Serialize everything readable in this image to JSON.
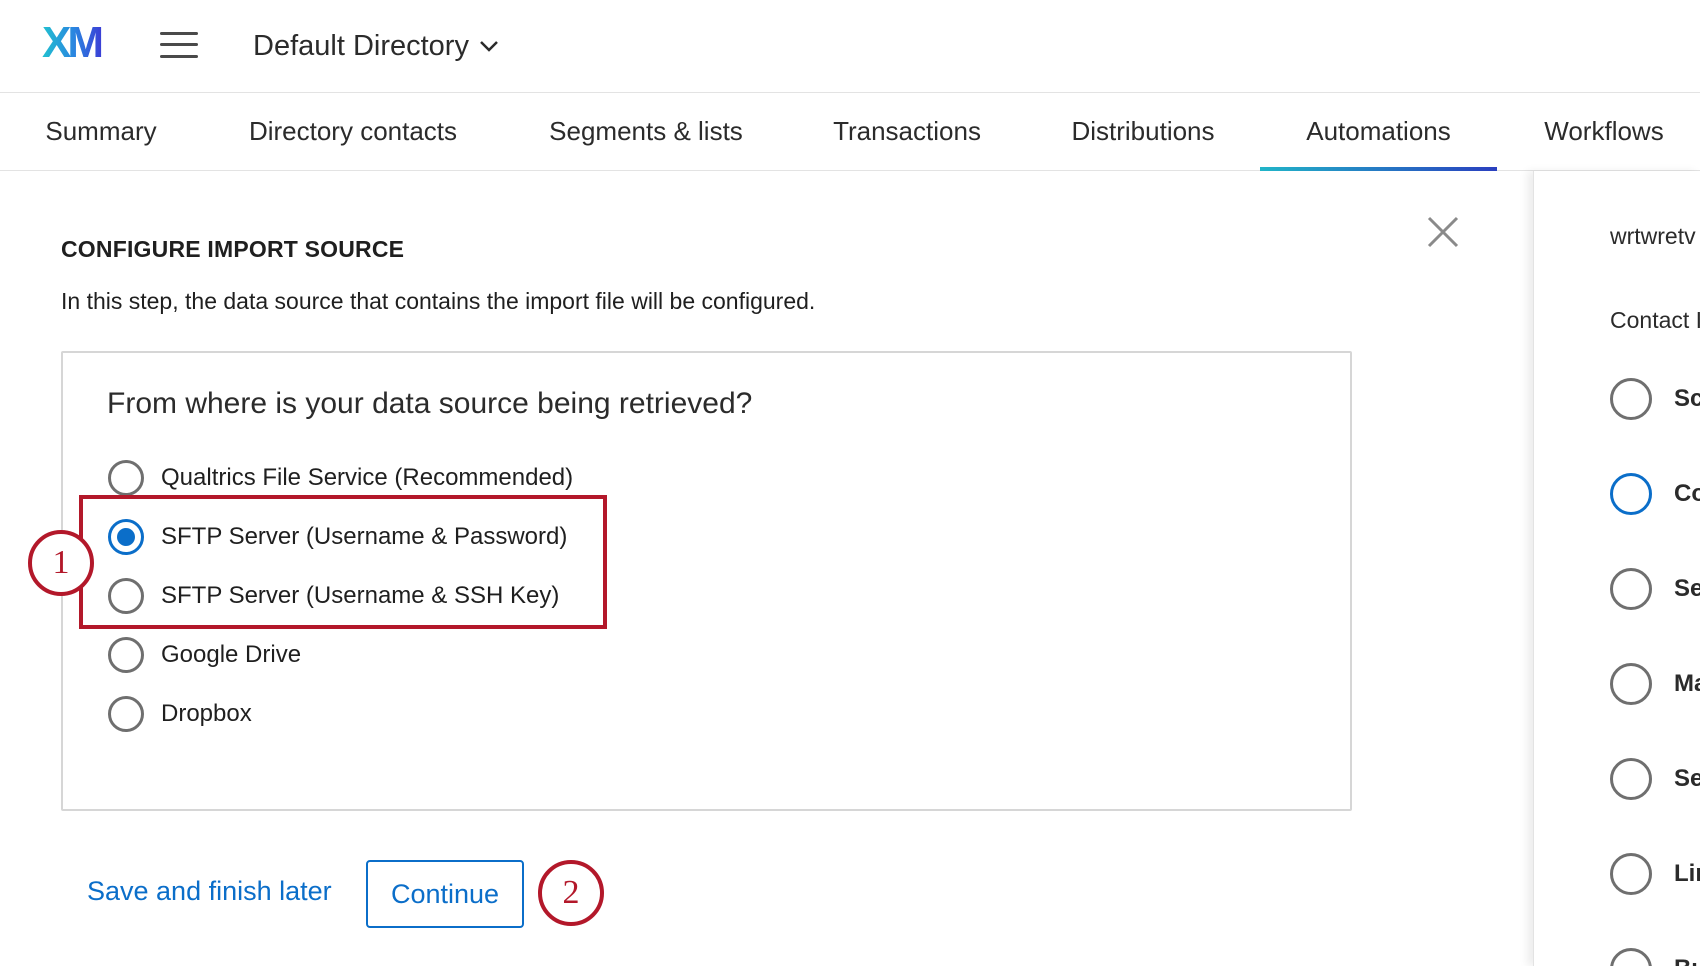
{
  "header": {
    "logo_text": "XM",
    "directory_name": "Default Directory"
  },
  "tabs": [
    {
      "label": "Summary",
      "active": false
    },
    {
      "label": "Directory contacts",
      "active": false
    },
    {
      "label": "Segments & lists",
      "active": false
    },
    {
      "label": "Transactions",
      "active": false
    },
    {
      "label": "Distributions",
      "active": false
    },
    {
      "label": "Automations",
      "active": true
    },
    {
      "label": "Workflows",
      "active": false
    }
  ],
  "panel": {
    "heading": "CONFIGURE IMPORT SOURCE",
    "description": "In this step, the data source that contains the import file will be configured.",
    "question": "From where is your data source being retrieved?",
    "options": [
      {
        "label": "Qualtrics File Service (Recommended)",
        "selected": false
      },
      {
        "label": "SFTP Server (Username & Password)",
        "selected": true
      },
      {
        "label": "SFTP Server (Username & SSH Key)",
        "selected": false
      },
      {
        "label": "Google Drive",
        "selected": false
      },
      {
        "label": "Dropbox",
        "selected": false
      }
    ],
    "save_label": "Save and finish later",
    "continue_label": "Continue"
  },
  "callouts": [
    "1",
    "2"
  ],
  "right_panel": {
    "title": "wrtwretv",
    "subtitle": "Contact I",
    "items": [
      {
        "label": "Sc",
        "active": false
      },
      {
        "label": "Co",
        "active": true
      },
      {
        "label": "Se",
        "active": false
      },
      {
        "label": "Ma",
        "active": false
      },
      {
        "label": "Se",
        "active": false
      },
      {
        "label": "Lir",
        "active": false
      },
      {
        "label": "Bu",
        "active": false
      }
    ]
  },
  "colors": {
    "accent": "#0b6ec9",
    "highlight": "#b3182a",
    "tab_underline_start": "#21b5c8",
    "tab_underline_end": "#2a3fbf"
  }
}
